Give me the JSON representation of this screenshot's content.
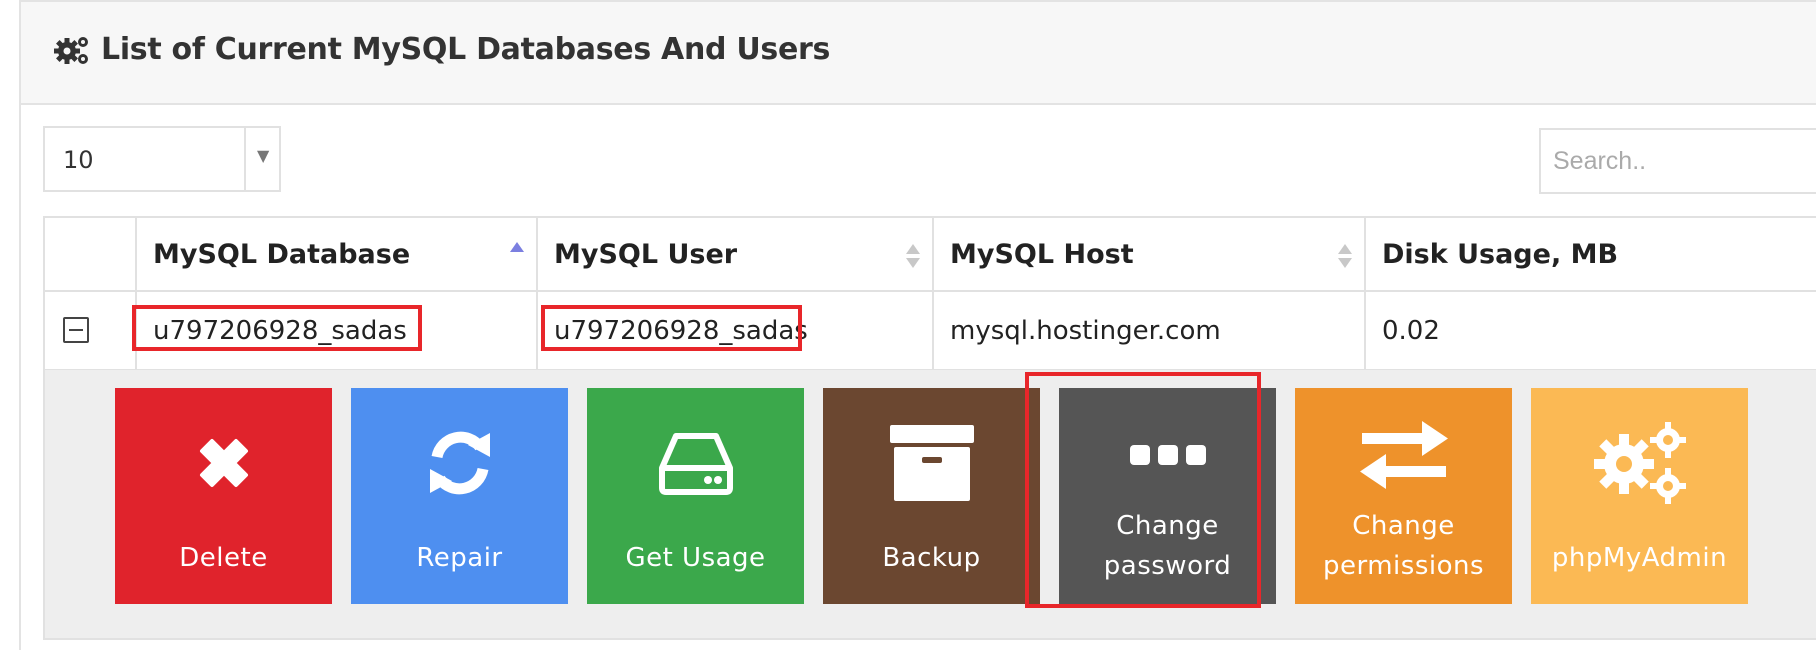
{
  "panel": {
    "title": "List of Current MySQL Databases And Users",
    "title_icon": "gears-icon"
  },
  "controls": {
    "page_size": "10",
    "search_placeholder": "Search.."
  },
  "table": {
    "columns": [
      "MySQL Database",
      "MySQL User",
      "MySQL Host",
      "Disk Usage, MB"
    ],
    "rows": [
      {
        "database": "u797206928_sadas",
        "user": "u797206928_sadas",
        "host": "mysql.hostinger.com",
        "disk_usage": "0.02"
      }
    ]
  },
  "actions": [
    {
      "label": "Delete",
      "icon": "x-icon",
      "color": "#e0232c"
    },
    {
      "label": "Repair",
      "icon": "refresh-icon",
      "color": "#4e8ff0"
    },
    {
      "label": "Get Usage",
      "icon": "hard-drive-icon",
      "color": "#3ba84b"
    },
    {
      "label": "Backup",
      "icon": "archive-box-icon",
      "color": "#6b4730"
    },
    {
      "label": "Change password",
      "line1": "Change",
      "line2": "password",
      "icon": "dots-icon",
      "color": "#555555"
    },
    {
      "label": "Change permissions",
      "line1": "Change",
      "line2": "permissions",
      "icon": "swap-arrows-icon",
      "color": "#ee922b"
    },
    {
      "label": "phpMyAdmin",
      "icon": "gears-icon",
      "color": "#fbb954"
    }
  ],
  "colors": {
    "highlight": "#e8262a",
    "sort_active": "#7b7fe0",
    "sort_inactive": "#c8c8c8"
  }
}
